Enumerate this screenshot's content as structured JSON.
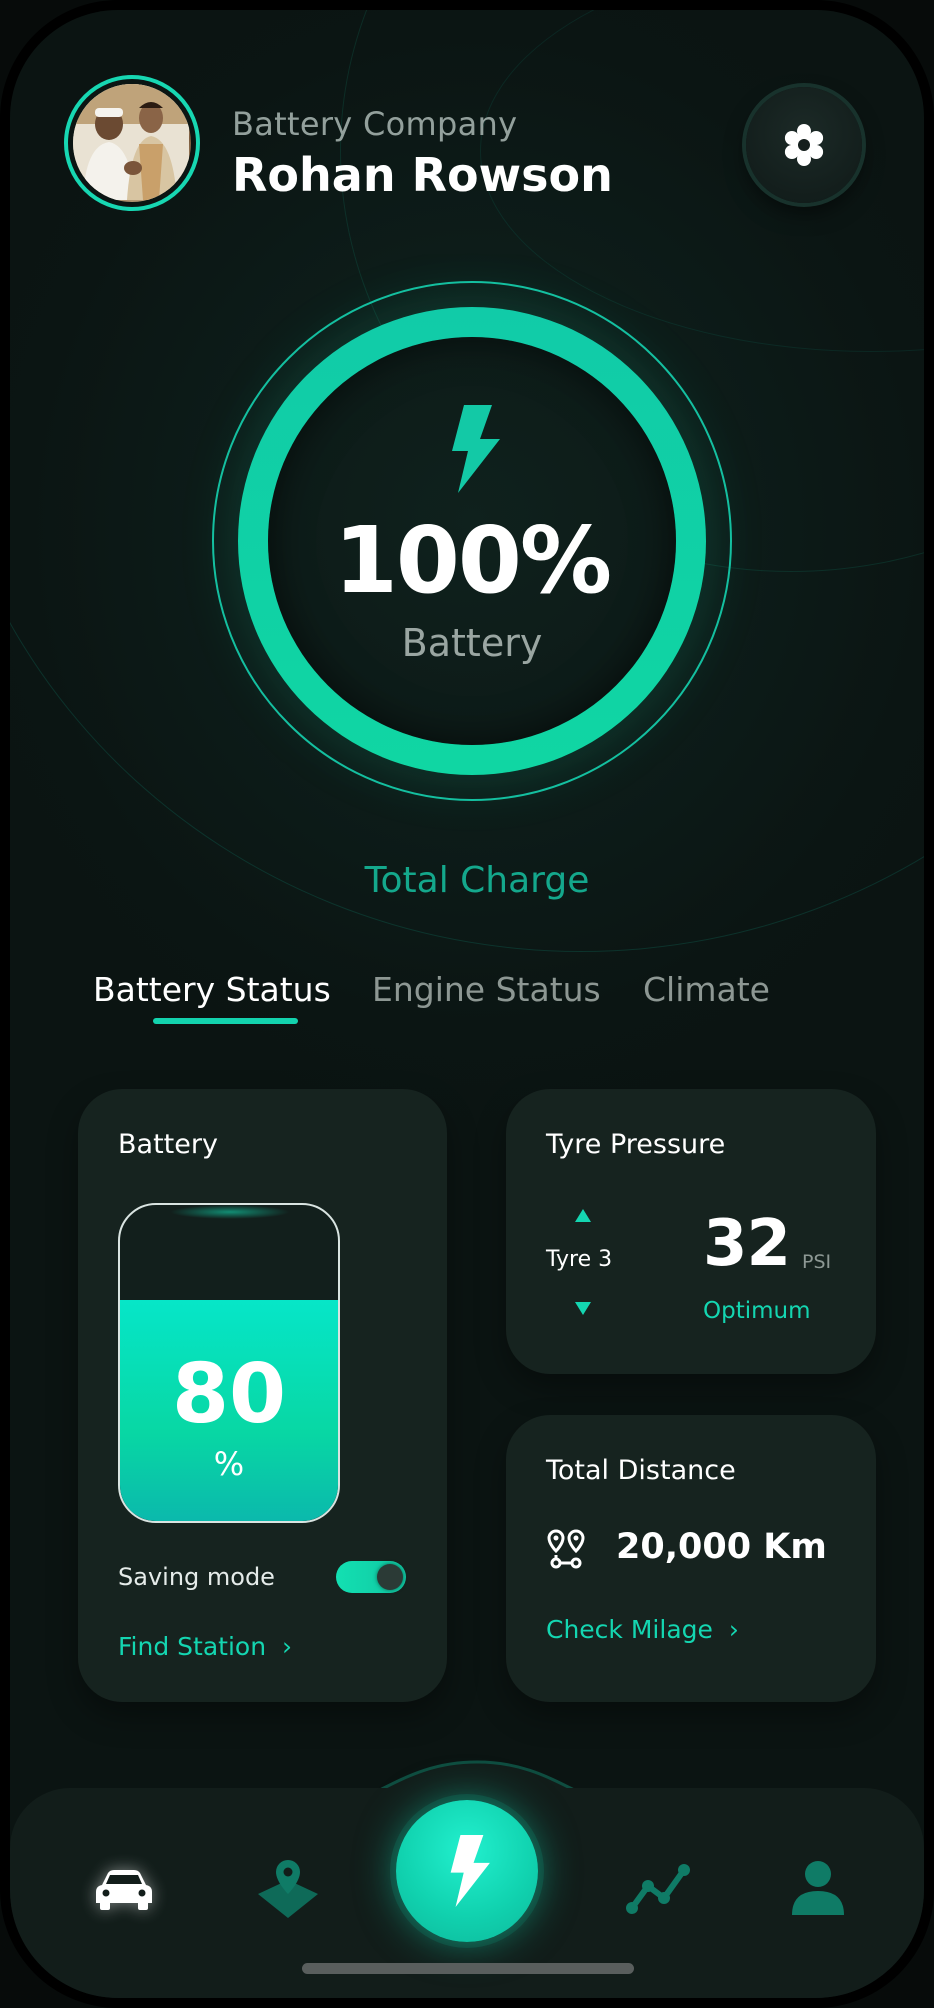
{
  "header": {
    "company": "Battery Company",
    "user_name": "Rohan Rowson"
  },
  "gauge": {
    "value": "100%",
    "label": "Battery",
    "caption": "Total Charge"
  },
  "tabs": [
    {
      "label": "Battery Status",
      "active": true
    },
    {
      "label": "Engine Status",
      "active": false
    },
    {
      "label": "Climate",
      "active": false
    }
  ],
  "battery_card": {
    "title": "Battery",
    "level_value": "80",
    "level_unit": "%",
    "level_fraction": 0.7,
    "saving_mode_label": "Saving mode",
    "saving_mode_on": true,
    "link": "Find Station"
  },
  "tyre_card": {
    "title": "Tyre Pressure",
    "tyre_label": "Tyre 3",
    "value": "32",
    "unit": "PSI",
    "status": "Optimum"
  },
  "distance_card": {
    "title": "Total Distance",
    "value": "20,000 Km",
    "link": "Check Milage"
  },
  "nav": {
    "items": [
      "car-icon",
      "map-pin-icon",
      "lightning-icon",
      "chart-icon",
      "user-icon"
    ],
    "active": "car-icon"
  },
  "colors": {
    "accent": "#13d6ae",
    "background": "#0b1513",
    "card": "#16231f"
  }
}
